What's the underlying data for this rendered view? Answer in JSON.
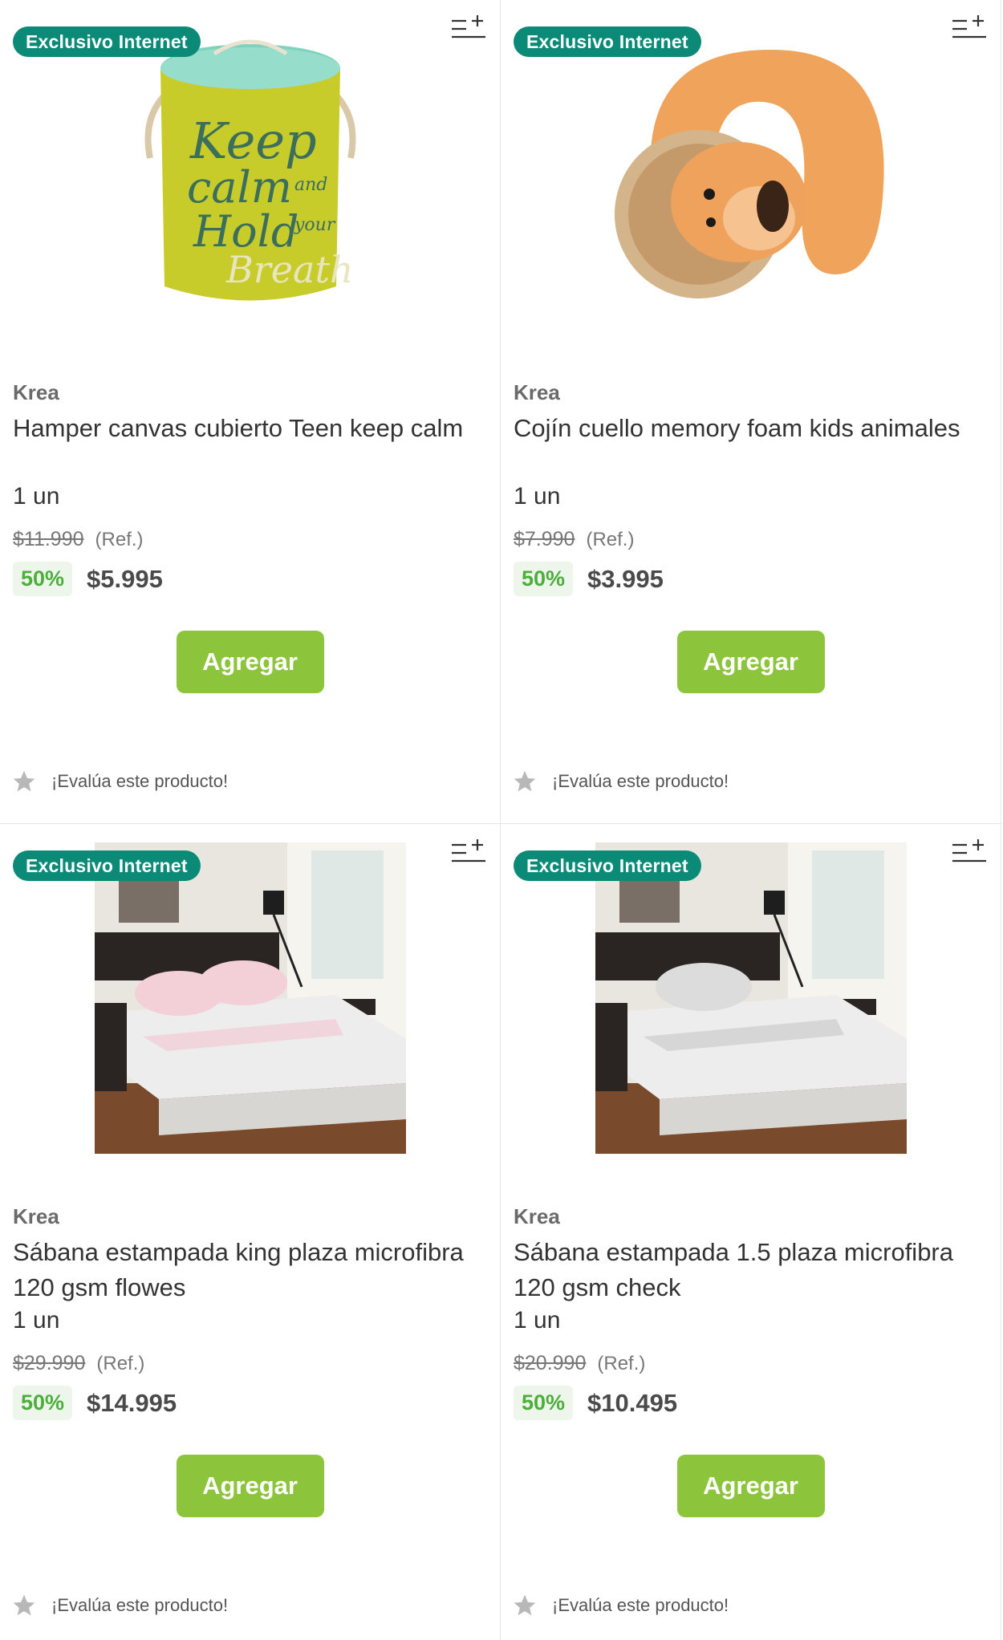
{
  "colors": {
    "badge_bg": "#0b8a78",
    "button_bg": "#8cc43c",
    "discount_text": "#4caf3c",
    "discount_bg": "#eef6ec"
  },
  "products": [
    {
      "badge": "Exclusivo Internet",
      "brand": "Krea",
      "name": "Hamper canvas cubierto Teen keep calm",
      "quantity": "1 un",
      "old_price": "$11.990",
      "ref": "(Ref.)",
      "discount": "50%",
      "price": "$5.995",
      "add_label": "Agregar",
      "rate_label": "¡Evalúa este producto!",
      "image": "keep-calm-hamper"
    },
    {
      "badge": "Exclusivo Internet",
      "brand": "Krea",
      "name": "Cojín cuello memory foam kids animales",
      "quantity": "1 un",
      "old_price": "$7.990",
      "ref": "(Ref.)",
      "discount": "50%",
      "price": "$3.995",
      "add_label": "Agregar",
      "rate_label": "¡Evalúa este producto!",
      "image": "lion-neck-pillow"
    },
    {
      "badge": "Exclusivo Internet",
      "brand": "Krea",
      "name": "Sábana estampada king plaza microfibra 120 gsm flowes",
      "quantity": "1 un",
      "old_price": "$29.990",
      "ref": "(Ref.)",
      "discount": "50%",
      "price": "$14.995",
      "add_label": "Agregar",
      "rate_label": "¡Evalúa este producto!",
      "image": "bed-sheet-flowers"
    },
    {
      "badge": "Exclusivo Internet",
      "brand": "Krea",
      "name": "Sábana estampada 1.5 plaza microfibra 120 gsm check",
      "quantity": "1 un",
      "old_price": "$20.990",
      "ref": "(Ref.)",
      "discount": "50%",
      "price": "$10.495",
      "add_label": "Agregar",
      "rate_label": "¡Evalúa este producto!",
      "image": "bed-sheet-check"
    }
  ],
  "hamper_text": {
    "line1": "Keep",
    "line2": "calm",
    "line3": "and",
    "line4": "Hold",
    "line5": "your",
    "line6": "Breath"
  }
}
